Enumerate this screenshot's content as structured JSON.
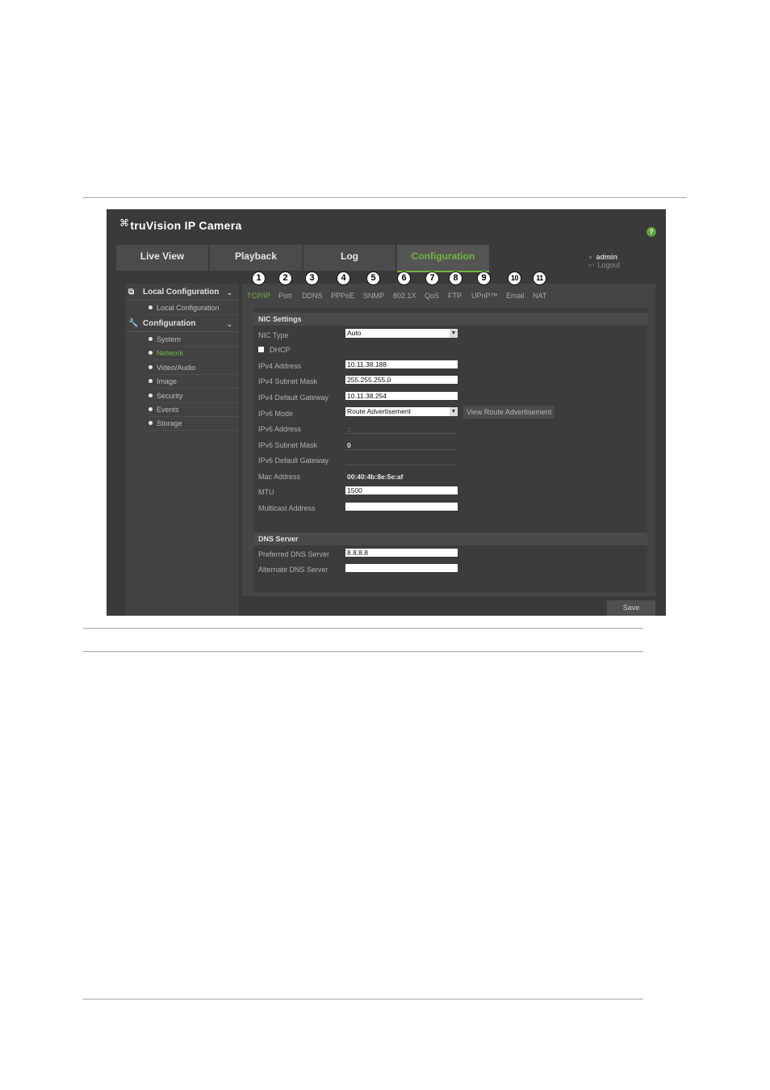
{
  "app": {
    "logo_text": "truVision",
    "logo_suffix": "IP Camera",
    "help_label": "?"
  },
  "nav": {
    "tabs": [
      {
        "label": "Live View"
      },
      {
        "label": "Playback"
      },
      {
        "label": "Log"
      },
      {
        "label": "Configuration",
        "active": true
      }
    ],
    "user": "admin",
    "logout": "Logout"
  },
  "sidebar": {
    "local_header": "Local Configuration",
    "local_items": [
      "Local Configuration"
    ],
    "config_header": "Configuration",
    "config_items": [
      "System",
      "Network",
      "Video/Audio",
      "Image",
      "Security",
      "Events",
      "Storage"
    ],
    "active_item": "Network"
  },
  "subtabs": [
    {
      "label": "TCP/IP",
      "num": "1",
      "active": true
    },
    {
      "label": "Port",
      "num": "2"
    },
    {
      "label": "DDNS",
      "num": "3"
    },
    {
      "label": "PPPoE",
      "num": "4"
    },
    {
      "label": "SNMP",
      "num": "5"
    },
    {
      "label": "802.1X",
      "num": "6"
    },
    {
      "label": "QoS",
      "num": "7"
    },
    {
      "label": "FTP",
      "num": "8"
    },
    {
      "label": "UPnP™",
      "num": "9"
    },
    {
      "label": "Email",
      "num": "10"
    },
    {
      "label": "NAT",
      "num": "11"
    }
  ],
  "nic": {
    "title": "NIC Settings",
    "nic_type_label": "NIC Type",
    "nic_type_value": "Auto",
    "dhcp_label": "DHCP",
    "ipv4_address_label": "IPv4 Address",
    "ipv4_address_value": "10.11.38.188",
    "ipv4_mask_label": "IPv4 Subnet Mask",
    "ipv4_mask_value": "255.255.255.0",
    "ipv4_gateway_label": "IPv4 Default Gateway",
    "ipv4_gateway_value": "10.11.38.254",
    "ipv6_mode_label": "IPv6 Mode",
    "ipv6_mode_value": "Route Advertisement",
    "view_route_label": "View Route Advertisement",
    "ipv6_address_label": "IPv6 Address",
    "ipv6_address_value": "::",
    "ipv6_mask_label": "IPv6 Subnet Mask",
    "ipv6_mask_value": "0",
    "ipv6_gateway_label": "IPv6 Default Gateway",
    "mac_label": "Mac Address",
    "mac_value": "00:40:4b:8e:5e:af",
    "mtu_label": "MTU",
    "mtu_value": "1500",
    "multicast_label": "Multicast Address",
    "multicast_value": ""
  },
  "dns": {
    "title": "DNS Server",
    "preferred_label": "Preferred DNS Server",
    "preferred_value": "8.8.8.8",
    "alternate_label": "Alternate DNS Server",
    "alternate_value": ""
  },
  "save_label": "Save"
}
